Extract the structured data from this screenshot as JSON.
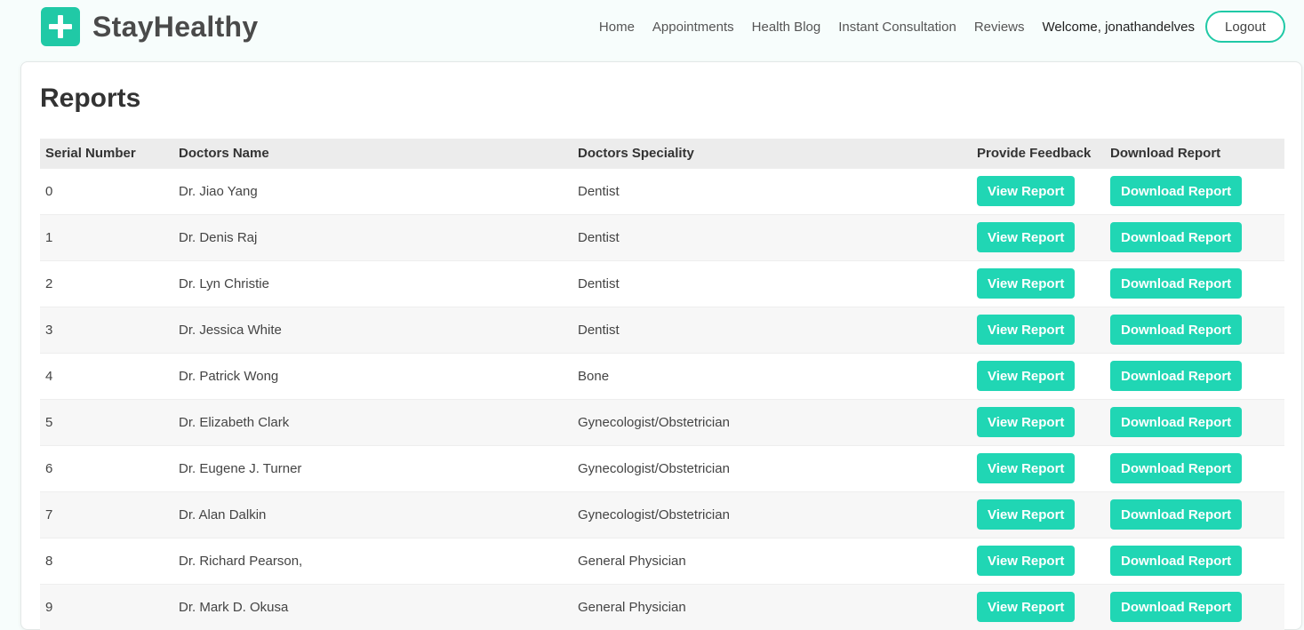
{
  "brand": {
    "name": "StayHealthy"
  },
  "nav": {
    "links": [
      "Home",
      "Appointments",
      "Health Blog",
      "Instant Consultation",
      "Reviews"
    ],
    "welcome": "Welcome, jonathandelves",
    "logout_label": "Logout"
  },
  "page": {
    "title": "Reports"
  },
  "table": {
    "headers": [
      "Serial Number",
      "Doctors Name",
      "Doctors Speciality",
      "Provide Feedback",
      "Download Report"
    ],
    "view_label": "View Report",
    "download_label": "Download Report",
    "rows": [
      {
        "serial": "0",
        "name": "Dr. Jiao Yang",
        "speciality": "Dentist"
      },
      {
        "serial": "1",
        "name": "Dr. Denis Raj",
        "speciality": "Dentist"
      },
      {
        "serial": "2",
        "name": "Dr. Lyn Christie",
        "speciality": "Dentist"
      },
      {
        "serial": "3",
        "name": "Dr. Jessica White",
        "speciality": "Dentist"
      },
      {
        "serial": "4",
        "name": "Dr. Patrick Wong",
        "speciality": "Bone"
      },
      {
        "serial": "5",
        "name": "Dr. Elizabeth Clark",
        "speciality": "Gynecologist/Obstetrician"
      },
      {
        "serial": "6",
        "name": "Dr. Eugene J. Turner",
        "speciality": "Gynecologist/Obstetrician"
      },
      {
        "serial": "7",
        "name": "Dr. Alan Dalkin",
        "speciality": "Gynecologist/Obstetrician"
      },
      {
        "serial": "8",
        "name": "Dr. Richard Pearson,",
        "speciality": "General Physician"
      },
      {
        "serial": "9",
        "name": "Dr. Mark D. Okusa",
        "speciality": "General Physician"
      }
    ]
  },
  "colors": {
    "accent": "#20d6b4",
    "brand": "#20c9a6"
  }
}
